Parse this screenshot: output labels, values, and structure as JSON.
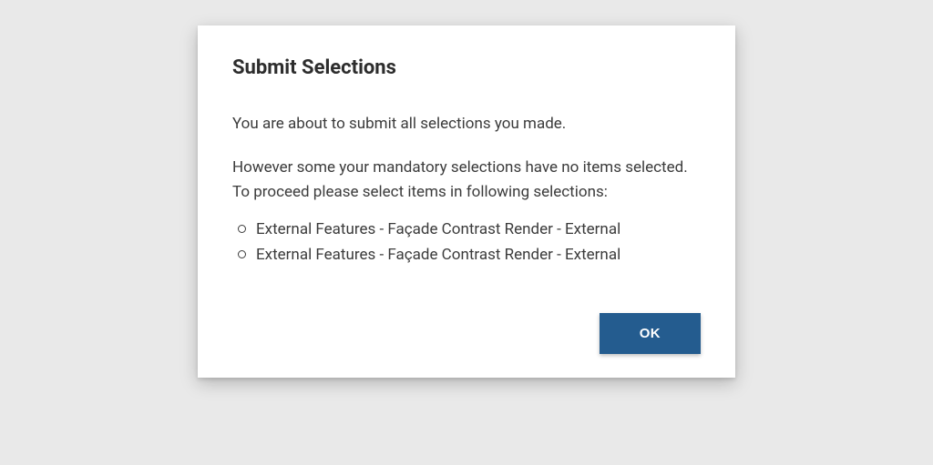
{
  "dialog": {
    "title": "Submit Selections",
    "intro": "You are about to submit all selections you made.",
    "warning": "However some your mandatory selections have no items selected. To proceed please select items in following selections:",
    "items": [
      "External Features - Façade Contrast Render - External",
      "External Features - Façade Contrast Render - External"
    ],
    "ok_label": "OK"
  }
}
